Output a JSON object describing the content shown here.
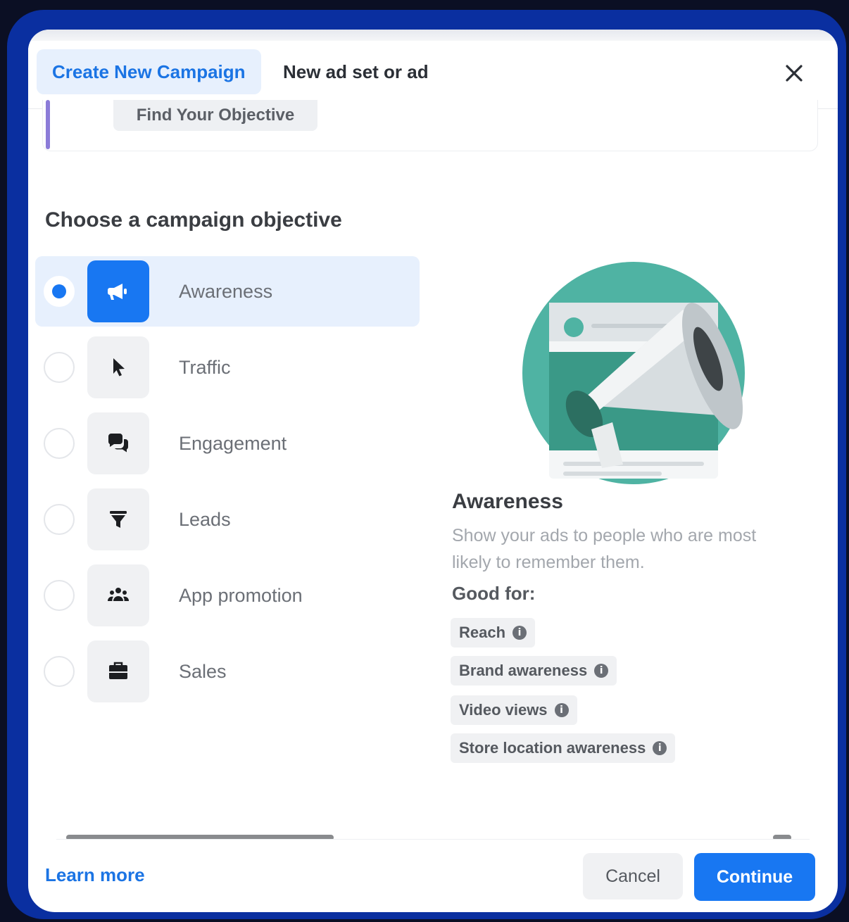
{
  "tabs": [
    {
      "label": "Create New Campaign",
      "active": true
    },
    {
      "label": "New ad set or ad",
      "active": false
    }
  ],
  "close": {
    "icon": "close-icon"
  },
  "find_objective": {
    "label": "Find Your Objective"
  },
  "section_title": "Choose a campaign objective",
  "objectives": [
    {
      "label": "Awareness",
      "icon": "megaphone-icon",
      "selected": true
    },
    {
      "label": "Traffic",
      "icon": "cursor-icon",
      "selected": false
    },
    {
      "label": "Engagement",
      "icon": "chat-bubbles-icon",
      "selected": false
    },
    {
      "label": "Leads",
      "icon": "funnel-icon",
      "selected": false
    },
    {
      "label": "App promotion",
      "icon": "people-icon",
      "selected": false
    },
    {
      "label": "Sales",
      "icon": "briefcase-icon",
      "selected": false
    }
  ],
  "detail": {
    "title": "Awareness",
    "description": "Show your ads to people who are most likely to remember them.",
    "good_for_label": "Good for:",
    "chips": [
      "Reach",
      "Brand awareness",
      "Video views",
      "Store location awareness"
    ]
  },
  "footer": {
    "learn_more": "Learn more",
    "cancel": "Cancel",
    "continue": "Continue"
  },
  "colors": {
    "accent": "#1877f2",
    "frame": "#0a2fa0",
    "selected_bg": "#e7f0fd",
    "illustration_teal": "#4fb3a3"
  }
}
